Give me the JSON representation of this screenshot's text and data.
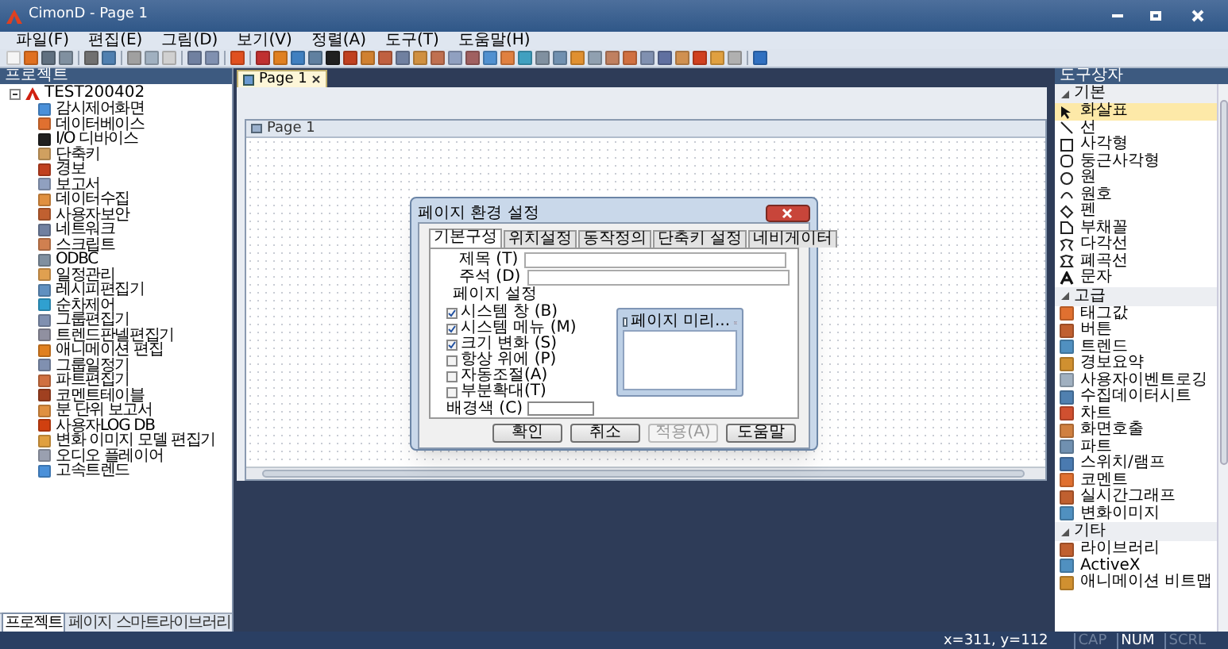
{
  "window": {
    "title": "CimonD - Page 1"
  },
  "menu": [
    "파일(F)",
    "편집(E)",
    "그림(D)",
    "보기(V)",
    "정렬(A)",
    "도구(T)",
    "도움말(H)"
  ],
  "project_panel": {
    "title": "프로젝트",
    "root": {
      "label": "TEST200402",
      "expanded": true,
      "children": [
        {
          "label": "감시제어화면"
        },
        {
          "label": "데이터베이스"
        },
        {
          "label": "I/O 디바이스"
        },
        {
          "label": "단축키"
        },
        {
          "label": "경보"
        },
        {
          "label": "보고서"
        },
        {
          "label": "데이터수집"
        },
        {
          "label": "사용자보안"
        },
        {
          "label": "네트워크"
        },
        {
          "label": "스크립트"
        },
        {
          "label": "ODBC"
        },
        {
          "label": "일정관리"
        },
        {
          "label": "레시피편집기"
        },
        {
          "label": "순차제어"
        },
        {
          "label": "그룹편집기"
        },
        {
          "label": "트렌드판넬편집기"
        },
        {
          "label": "애니메이션 편집"
        },
        {
          "label": "그룹일정기"
        },
        {
          "label": "파트편집기"
        },
        {
          "label": "코멘트테이블"
        },
        {
          "label": "분 단위 보고서"
        },
        {
          "label": "사용자LOG DB"
        },
        {
          "label": "변화 이미지 모델 편집기"
        },
        {
          "label": "오디오 플레이어"
        },
        {
          "label": "고속트렌드"
        }
      ]
    },
    "tabs": [
      {
        "label": "프로젝트",
        "selected": true
      },
      {
        "label": "페이지",
        "selected": false
      },
      {
        "label": "스마트라이브러리",
        "selected": false
      }
    ]
  },
  "document_tab": {
    "label": "Page 1"
  },
  "page_window": {
    "title": "Page 1"
  },
  "dialog": {
    "title": "페이지 환경 설정",
    "tabs": [
      {
        "label": "기본구성",
        "selected": true
      },
      {
        "label": "위치설정",
        "selected": false
      },
      {
        "label": "동작정의",
        "selected": false
      },
      {
        "label": "단축키 설정",
        "selected": false
      },
      {
        "label": "네비게이터",
        "selected": false
      }
    ],
    "fields": [
      {
        "label": "제목 (T)"
      },
      {
        "label": "주석 (D)"
      }
    ],
    "group_title": "페이지 설정",
    "checkboxes": [
      {
        "label": "시스템 창 (B)",
        "checked": true
      },
      {
        "label": "시스템 메뉴 (M)",
        "checked": true
      },
      {
        "label": "크기 변화 (S)",
        "checked": true
      },
      {
        "label": "항상 위에 (P)",
        "checked": false
      },
      {
        "label": "자동조절(A)",
        "checked": false
      },
      {
        "label": "부분확대(T)",
        "checked": false
      }
    ],
    "background_label": "배경색 (C)",
    "preview_title": "페이지 미리...",
    "buttons": [
      {
        "label": "확인",
        "disabled": false
      },
      {
        "label": "취소",
        "disabled": false
      },
      {
        "label": "적용(A)",
        "disabled": true
      },
      {
        "label": "도움말",
        "disabled": false
      }
    ]
  },
  "toolbox": {
    "title": "도구상자",
    "sections": [
      {
        "label": "기본",
        "expanded": true,
        "items": [
          {
            "label": "화살표",
            "selected": true
          },
          {
            "label": "선",
            "selected": false
          },
          {
            "label": "사각형",
            "selected": false
          },
          {
            "label": "둥근사각형",
            "selected": false
          },
          {
            "label": "원",
            "selected": false
          },
          {
            "label": "원호",
            "selected": false
          },
          {
            "label": "펜",
            "selected": false
          },
          {
            "label": "부채꼴",
            "selected": false
          },
          {
            "label": "다각선",
            "selected": false
          },
          {
            "label": "폐곡선",
            "selected": false
          },
          {
            "label": "문자",
            "selected": false
          }
        ]
      },
      {
        "label": "고급",
        "expanded": true,
        "items": [
          {
            "label": "태그값",
            "selected": false
          },
          {
            "label": "버튼",
            "selected": false
          },
          {
            "label": "트렌드",
            "selected": false
          },
          {
            "label": "경보요약",
            "selected": false
          },
          {
            "label": "사용자이벤트로깅",
            "selected": false
          },
          {
            "label": "수집데이터시트",
            "selected": false
          },
          {
            "label": "차트",
            "selected": false
          },
          {
            "label": "화면호출",
            "selected": false
          },
          {
            "label": "파트",
            "selected": false
          },
          {
            "label": "스위치/램프",
            "selected": false
          },
          {
            "label": "코멘트",
            "selected": false
          },
          {
            "label": "실시간그래프",
            "selected": false
          },
          {
            "label": "변화이미지",
            "selected": false
          }
        ]
      },
      {
        "label": "기타",
        "expanded": true,
        "items": [
          {
            "label": "라이브러리",
            "selected": false
          },
          {
            "label": "ActiveX",
            "selected": false
          },
          {
            "label": "애니메이션 비트맵",
            "selected": false
          }
        ]
      }
    ]
  },
  "status_bar": {
    "coordinates": "x=311, y=112",
    "indicators": [
      {
        "label": "CAP",
        "on": false
      },
      {
        "label": "NUM",
        "on": true
      },
      {
        "label": "SCRL",
        "on": false
      }
    ]
  }
}
